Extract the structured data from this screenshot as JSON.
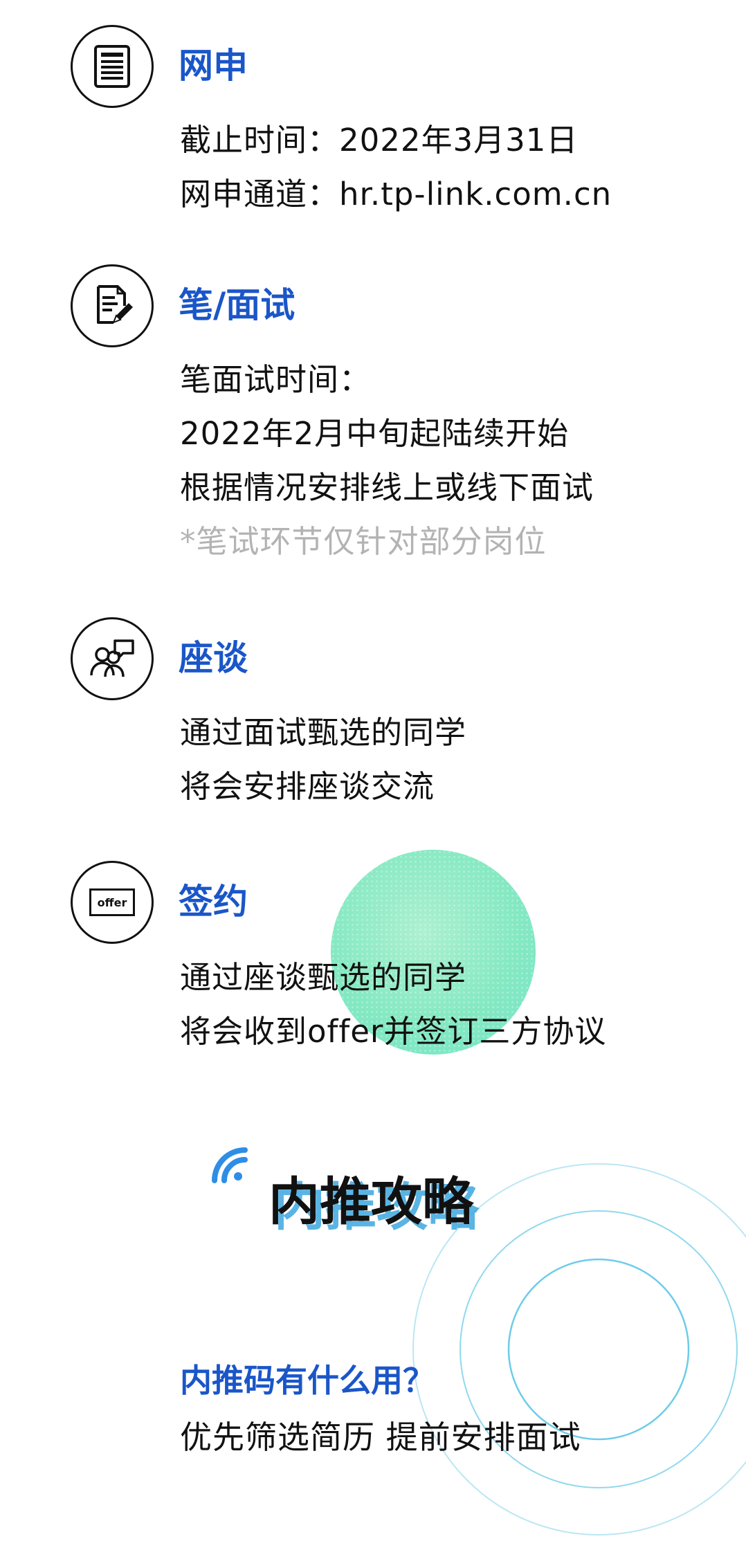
{
  "steps": [
    {
      "title": "网申",
      "icon": "document-icon",
      "lines": [
        "截止时间：2022年3月31日",
        "网申通道：hr.tp-link.com.cn"
      ]
    },
    {
      "title": "笔/面试",
      "icon": "edit-document-icon",
      "lines": [
        "笔面试时间：",
        "2022年2月中旬起陆续开始",
        "根据情况安排线上或线下面试"
      ],
      "note": "*笔试环节仅针对部分岗位"
    },
    {
      "title": "座谈",
      "icon": "discussion-people-icon",
      "lines": [
        "通过面试甄选的同学",
        "将会安排座谈交流"
      ]
    },
    {
      "title": "签约",
      "icon": "offer-icon",
      "icon_label": "offer",
      "lines": [
        "通过座谈甄选的同学",
        "将会收到offer并签订三方协议"
      ]
    }
  ],
  "section": {
    "title": "内推攻略",
    "question": "内推码有什么用？",
    "answer": "优先筛选简历 提前安排面试"
  },
  "colors": {
    "accent_blue": "#1a56c8",
    "title_shadow": "#3da8e0",
    "note_gray": "#b3b3b3",
    "green_circle": "#7fe8bf",
    "ring": "#7fd3ea"
  }
}
